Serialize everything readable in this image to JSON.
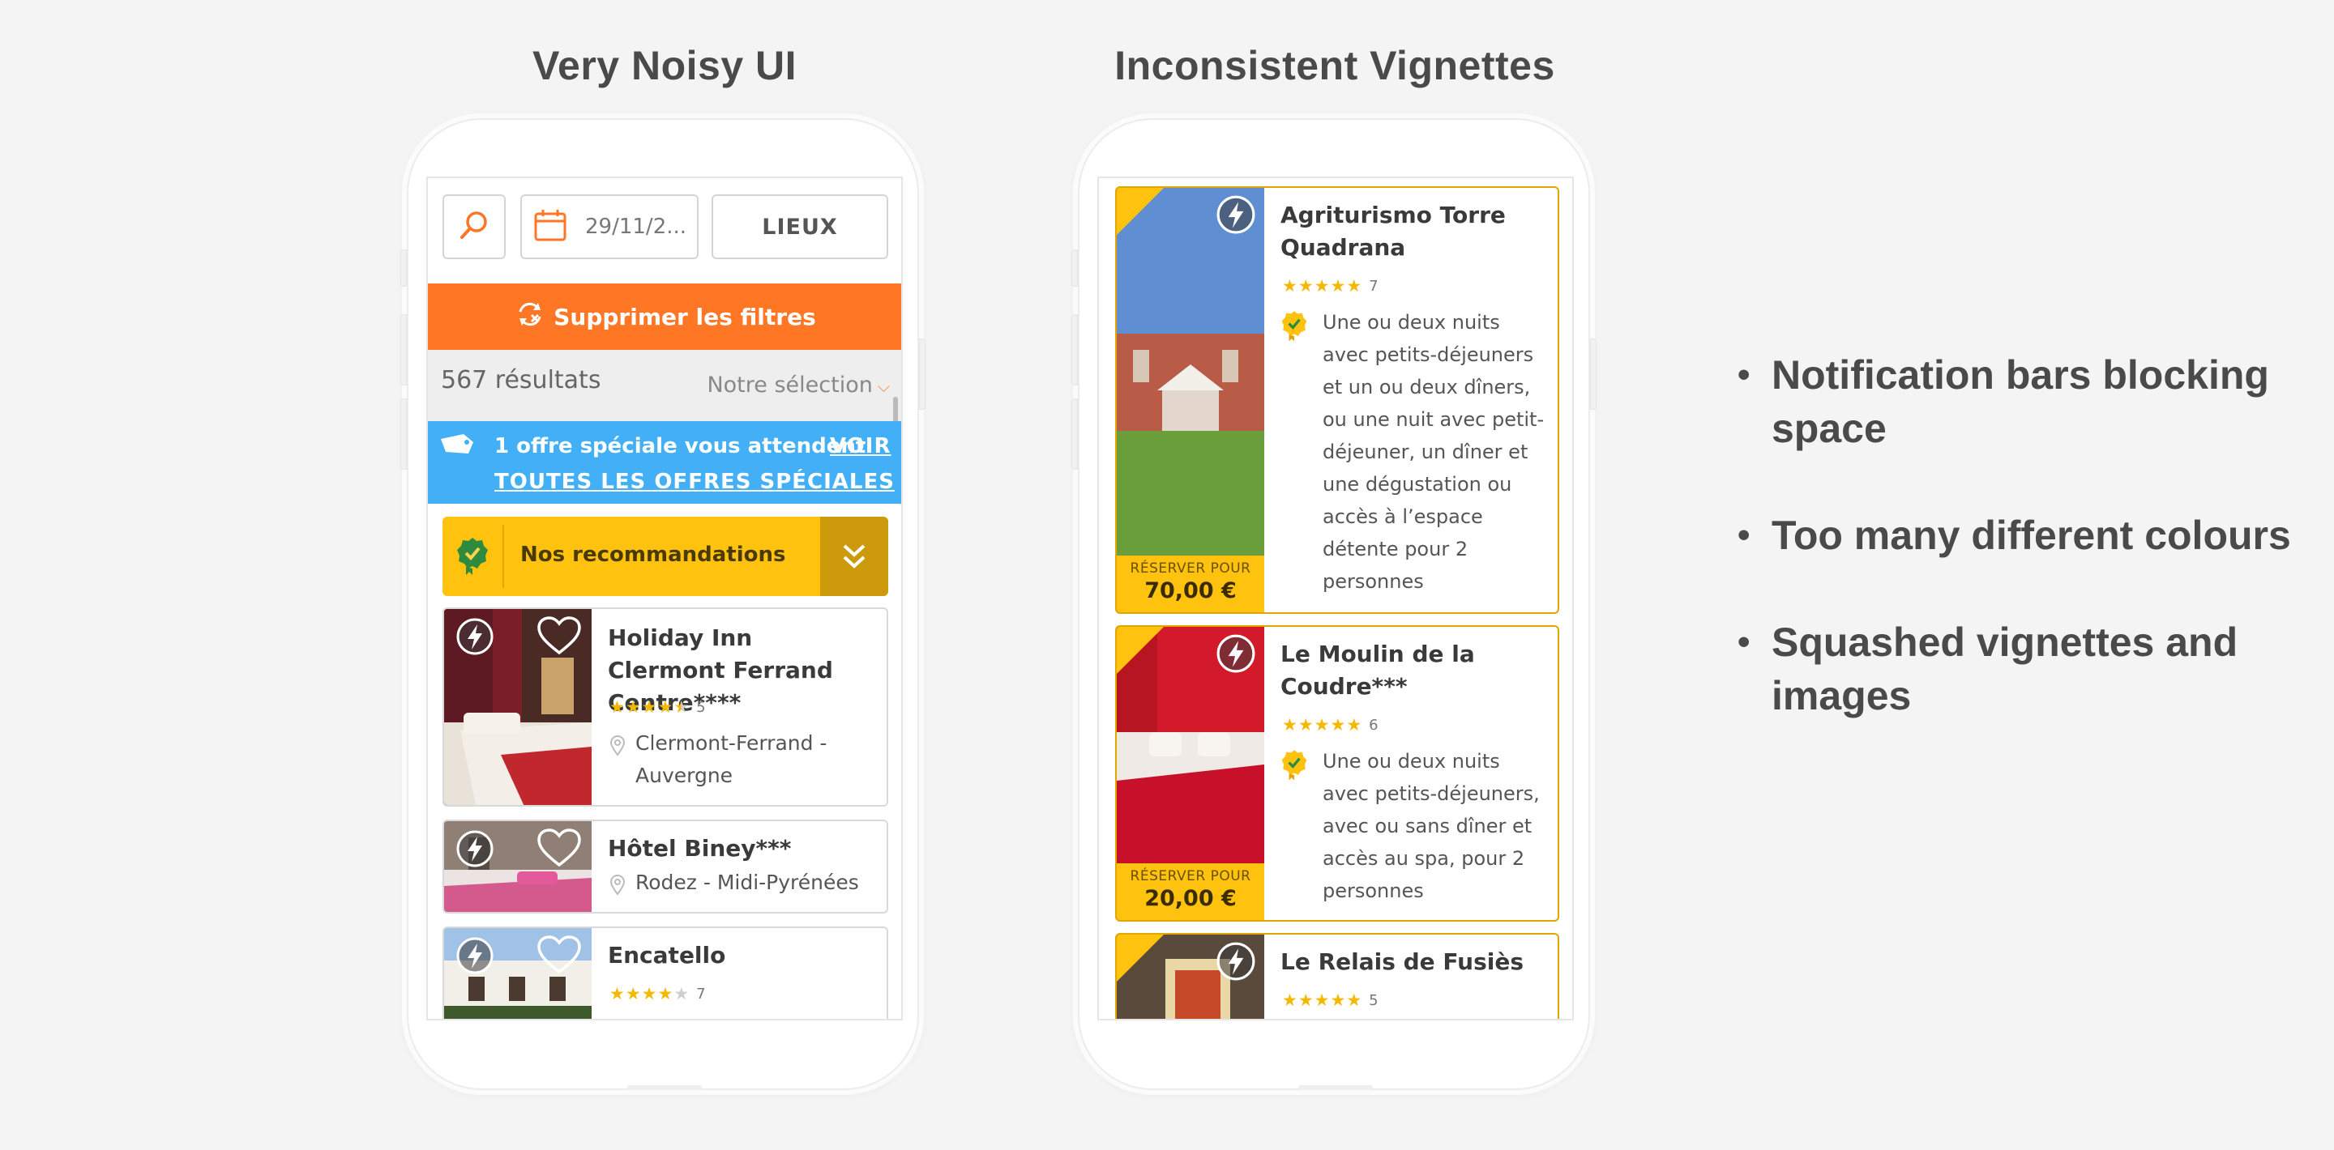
{
  "titles": {
    "left": "Very Noisy UI",
    "right": "Inconsistent Vignettes"
  },
  "colors": {
    "orange": "#ff7625",
    "blue": "#42aff7",
    "yellow": "#ffc20e",
    "dark_yellow": "#cc9a0a",
    "star": "#f5b800"
  },
  "phone1": {
    "search_icon": "search-icon",
    "date_value": "29/11/2...",
    "places_label": "LIEUX",
    "filter_label": "Supprimer les filtres",
    "results_count": "567 résultats",
    "sort_label": "Notre sélection",
    "offer_text": "1 offre spéciale vous attendent !",
    "offer_link_1": "VOIR",
    "offer_link_2": "TOUTES LES OFFRES SPÉCIALES",
    "reco_label": "Nos recommandations",
    "hotels": [
      {
        "name": "Holiday Inn Clermont Ferrand Centre****",
        "rating": 4.5,
        "count": "5",
        "location": "Clermont-Ferrand - Auvergne"
      },
      {
        "name": "Hôtel Biney***",
        "location": "Rodez - Midi-Pyrénées"
      },
      {
        "name": "Encatello",
        "rating": 4,
        "count": "7"
      }
    ]
  },
  "phone2": {
    "vignettes": [
      {
        "name": "Agriturismo Torre Quadrana",
        "rating": 5,
        "count": "7",
        "description": "Une ou deux nuits avec petits-déjeuners et un ou deux dîners, ou une nuit avec petit-déjeuner, un dîner et une dégustation ou accès à l’espace détente pour 2 personnes",
        "price_label": "RÉSERVER POUR",
        "price": "70,00 €"
      },
      {
        "name": "Le Moulin de la Coudre***",
        "rating": 5,
        "count": "6",
        "description": "Une ou deux nuits avec petits-déjeuners, avec ou sans dîner et accès au spa, pour 2 personnes",
        "price_label": "RÉSERVER POUR",
        "price": "20,00 €"
      },
      {
        "name": "Le Relais de Fusiès",
        "rating": 5,
        "count": "5"
      }
    ]
  },
  "bullets": [
    "Notification bars blocking space",
    "Too many different colours",
    "Squashed vignettes and images"
  ]
}
